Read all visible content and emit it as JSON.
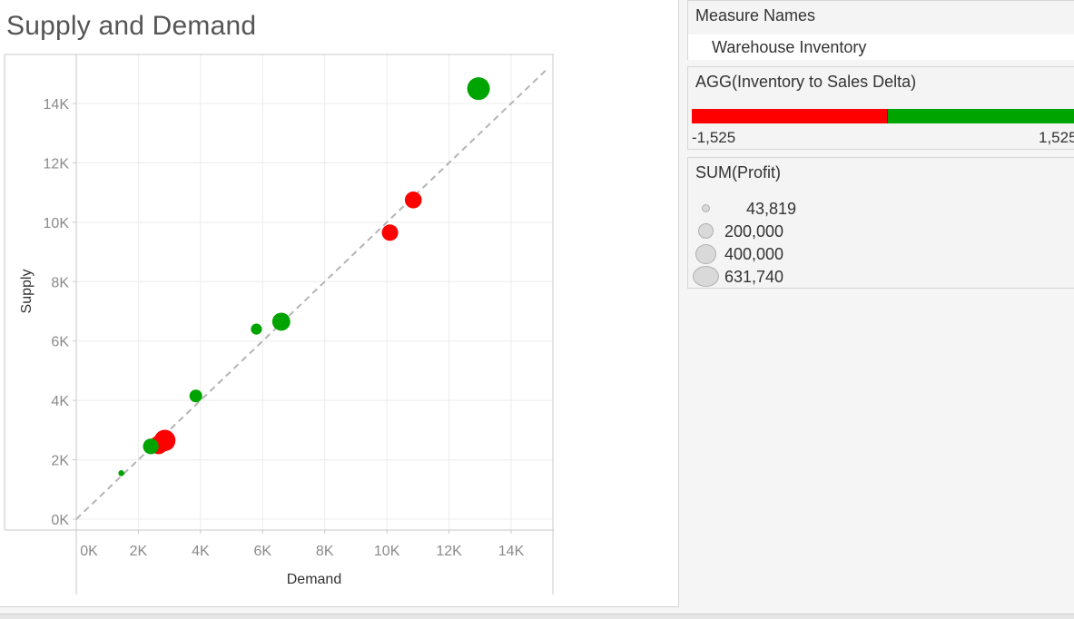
{
  "chart_data": {
    "type": "scatter",
    "title": "Supply and Demand",
    "xlabel": "Demand",
    "ylabel": "Supply",
    "xlim": [
      -300,
      15500
    ],
    "ylim": [
      -400,
      15500
    ],
    "x_ticks": [
      0,
      2000,
      4000,
      6000,
      8000,
      10000,
      12000,
      14000
    ],
    "x_tick_labels": [
      "0K",
      "2K",
      "4K",
      "6K",
      "8K",
      "10K",
      "12K",
      "14K"
    ],
    "y_ticks": [
      0,
      2000,
      4000,
      6000,
      8000,
      10000,
      12000,
      14000
    ],
    "y_tick_labels": [
      "0K",
      "2K",
      "4K",
      "6K",
      "8K",
      "10K",
      "12K",
      "14K"
    ],
    "grid": true,
    "reference_line": "y = x, dashed",
    "points": [
      {
        "x": 12950,
        "y": 14500,
        "profit": 631740,
        "color": "#00a400"
      },
      {
        "x": 10850,
        "y": 10750,
        "profit": 350000,
        "color": "#ff0000"
      },
      {
        "x": 10100,
        "y": 9650,
        "profit": 330000,
        "color": "#ff0000"
      },
      {
        "x": 6600,
        "y": 6650,
        "profit": 400000,
        "color": "#00a400"
      },
      {
        "x": 5800,
        "y": 6400,
        "profit": 150000,
        "color": "#00a400"
      },
      {
        "x": 3850,
        "y": 4150,
        "profit": 200000,
        "color": "#00a400"
      },
      {
        "x": 2650,
        "y": 2500,
        "profit": 420000,
        "color": "#ff0000"
      },
      {
        "x": 2850,
        "y": 2650,
        "profit": 560000,
        "color": "#ff0000"
      },
      {
        "x": 2400,
        "y": 2450,
        "profit": 300000,
        "color": "#00a400"
      },
      {
        "x": 1450,
        "y": 1550,
        "profit": 43819,
        "color": "#00a400"
      }
    ]
  },
  "legend": {
    "measure_names": {
      "title": "Measure Names",
      "item": "Warehouse Inventory"
    },
    "color": {
      "title": "AGG(Inventory to Sales Delta)",
      "min_label": "-1,525",
      "max_label": "1,525",
      "negative_color": "#ff0000",
      "positive_color": "#00a400"
    },
    "size": {
      "title": "SUM(Profit)",
      "items": [
        "43,819",
        "200,000",
        "400,000",
        "631,740"
      ],
      "values": [
        43819,
        200000,
        400000,
        631740
      ]
    }
  }
}
